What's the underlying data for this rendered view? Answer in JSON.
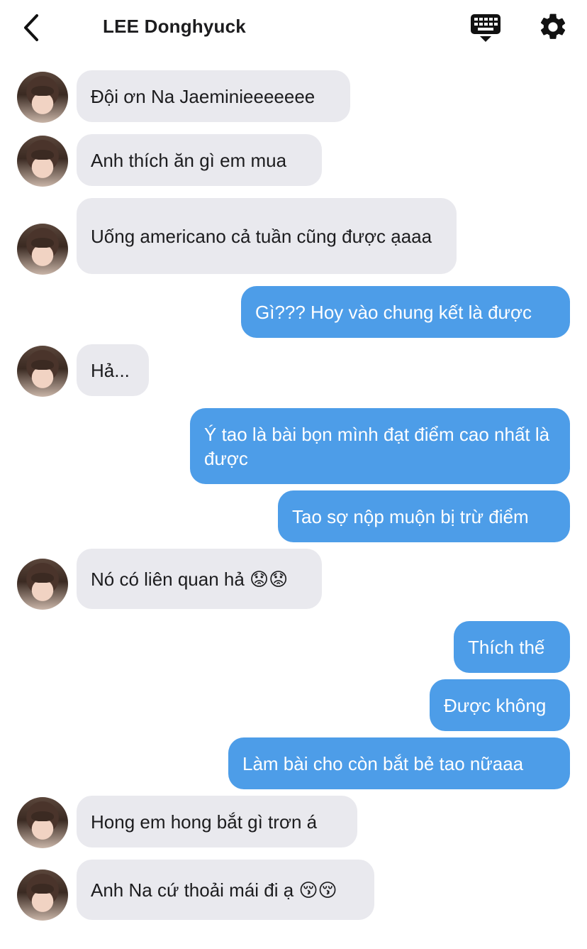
{
  "header": {
    "contact_name": "LEE Donghyuck",
    "back_icon": "chevron-left-icon",
    "keyboard_icon": "keyboard-icon",
    "settings_icon": "gear-icon"
  },
  "colors": {
    "outgoing_bubble": "#4d9de8",
    "incoming_bubble": "#e9e9ee"
  },
  "messages": [
    {
      "sender": "them",
      "text": "Đội ơn Na Jaeminieeeeeee"
    },
    {
      "sender": "them",
      "text": "Anh thích ăn gì em mua"
    },
    {
      "sender": "them",
      "text": "Uống americano cả tuần cũng được ạaaa"
    },
    {
      "sender": "me",
      "text": "Gì??? Hoy vào chung kết là được"
    },
    {
      "sender": "them",
      "text": "Hả..."
    },
    {
      "sender": "me",
      "text": "Ý tao là bài bọn mình đạt điểm cao nhất là được"
    },
    {
      "sender": "me",
      "text": "Tao sợ nộp muộn bị trừ điểm"
    },
    {
      "sender": "them",
      "text": "Nó có liên quan hả 😟😟"
    },
    {
      "sender": "me",
      "text": "Thích thế"
    },
    {
      "sender": "me",
      "text": "Được không"
    },
    {
      "sender": "me",
      "text": "Làm bài cho còn bắt bẻ tao nữaaa"
    },
    {
      "sender": "them",
      "text": "Hong em hong bắt gì trơn á"
    },
    {
      "sender": "them",
      "text": "Anh Na cứ thoải mái đi ạ 😚😚"
    }
  ]
}
